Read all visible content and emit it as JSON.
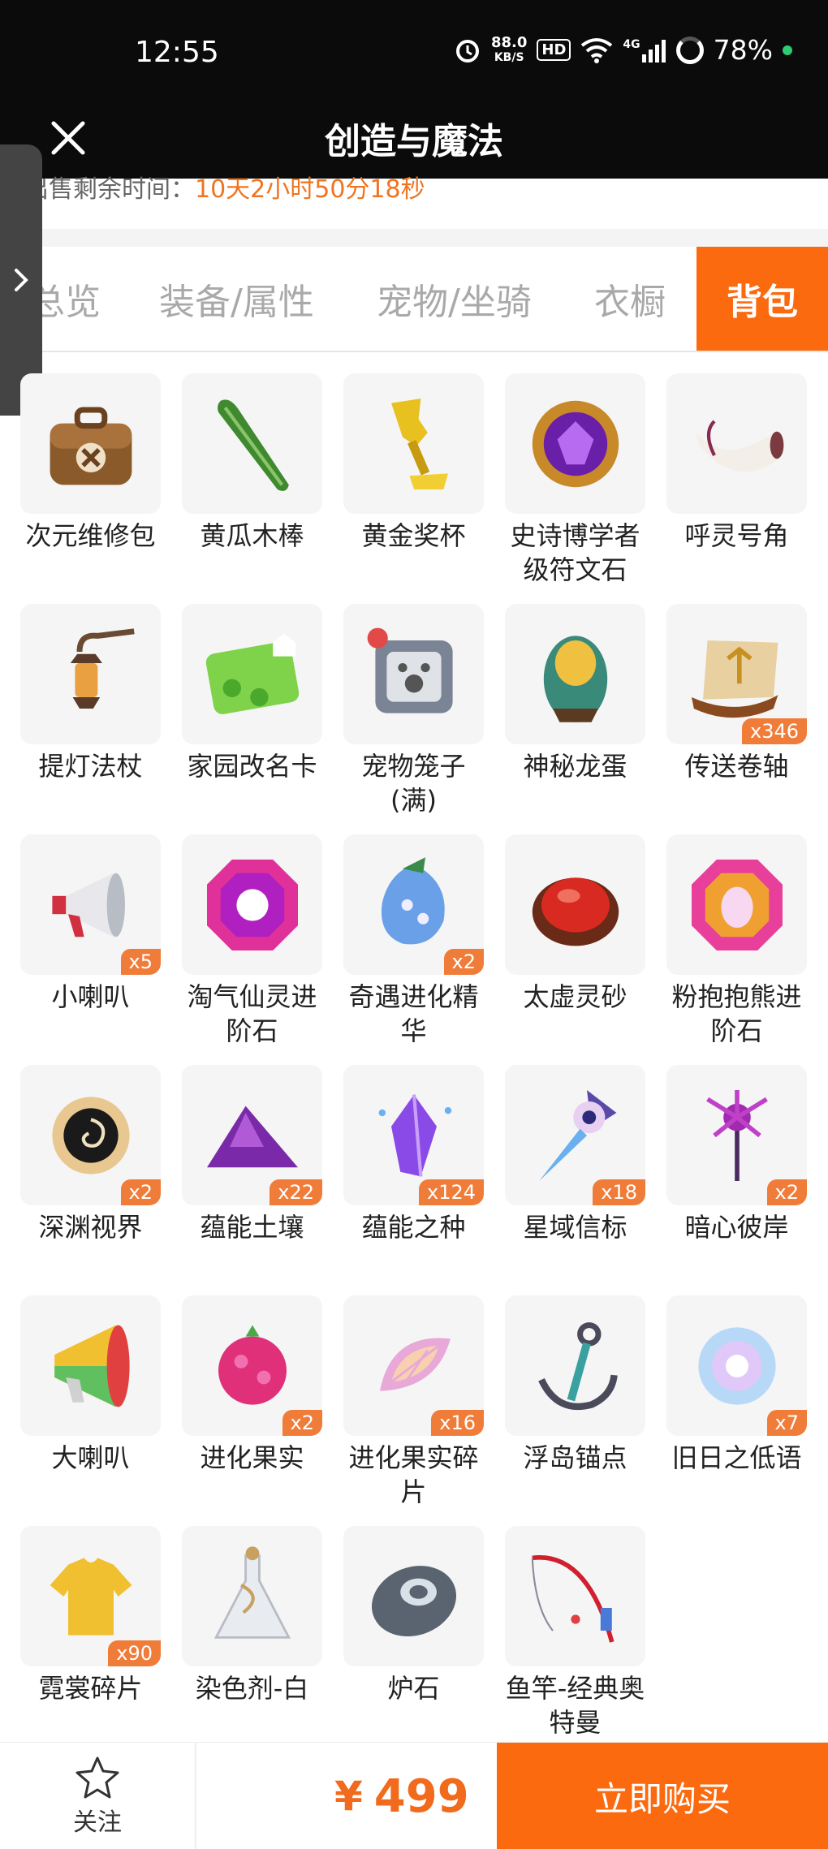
{
  "status_bar": {
    "time": "12:55",
    "net_speed_value": "88.0",
    "net_speed_unit": "KB/S",
    "hd_label": "HD",
    "network_label": "4G",
    "battery": "78%"
  },
  "header": {
    "title": "创造与魔法",
    "close_icon": "close-icon"
  },
  "sale": {
    "label": "出售剩余时间：",
    "countdown": "10天2小时50分18秒"
  },
  "tabs": [
    {
      "label": "总览",
      "active": false
    },
    {
      "label": "装备/属性",
      "active": false
    },
    {
      "label": "宠物/坐骑",
      "active": false
    },
    {
      "label": "衣橱",
      "active": false
    },
    {
      "label": "背包",
      "active": true
    }
  ],
  "items": [
    {
      "name": "次元维修包",
      "qty": "",
      "icon": "repair-bag-icon"
    },
    {
      "name": "黄瓜木棒",
      "qty": "",
      "icon": "cucumber-stick-icon"
    },
    {
      "name": "黄金奖杯",
      "qty": "",
      "icon": "golden-trophy-icon"
    },
    {
      "name": "史诗博学者级符文石",
      "qty": "",
      "icon": "epic-rune-stone-icon"
    },
    {
      "name": "呼灵号角",
      "qty": "",
      "icon": "summon-horn-icon"
    },
    {
      "name": "提灯法杖",
      "qty": "",
      "icon": "lantern-staff-icon"
    },
    {
      "name": "家园改名卡",
      "qty": "",
      "icon": "rename-card-icon"
    },
    {
      "name": "宠物笼子(满)",
      "qty": "",
      "icon": "pet-cage-icon"
    },
    {
      "name": "神秘龙蛋",
      "qty": "",
      "icon": "dragon-egg-icon"
    },
    {
      "name": "传送卷轴",
      "qty": "x346",
      "icon": "teleport-scroll-icon"
    },
    {
      "name": "小喇叭",
      "qty": "x5",
      "icon": "small-megaphone-icon"
    },
    {
      "name": "淘气仙灵进阶石",
      "qty": "",
      "icon": "fairy-advance-stone-icon"
    },
    {
      "name": "奇遇进化精华",
      "qty": "x2",
      "icon": "evolution-essence-icon"
    },
    {
      "name": "太虚灵砂",
      "qty": "",
      "icon": "spirit-sand-icon"
    },
    {
      "name": "粉抱抱熊进阶石",
      "qty": "",
      "icon": "bear-advance-stone-icon"
    },
    {
      "name": "深渊视界",
      "qty": "x2",
      "icon": "abyss-vision-icon"
    },
    {
      "name": "蕴能土壤",
      "qty": "x22",
      "icon": "energy-soil-icon"
    },
    {
      "name": "蕴能之种",
      "qty": "x124",
      "icon": "energy-seed-icon"
    },
    {
      "name": "星域信标",
      "qty": "x18",
      "icon": "star-beacon-icon"
    },
    {
      "name": "暗心彼岸",
      "qty": "x2",
      "icon": "dark-flower-icon"
    },
    {
      "name": "大喇叭",
      "qty": "",
      "icon": "big-megaphone-icon"
    },
    {
      "name": "进化果实",
      "qty": "x2",
      "icon": "evolution-fruit-icon"
    },
    {
      "name": "进化果实碎片",
      "qty": "x16",
      "icon": "fruit-fragment-icon"
    },
    {
      "name": "浮岛锚点",
      "qty": "",
      "icon": "island-anchor-icon"
    },
    {
      "name": "旧日之低语",
      "qty": "x7",
      "icon": "old-whisper-orb-icon"
    },
    {
      "name": "霓裳碎片",
      "qty": "x90",
      "icon": "clothing-fragment-icon"
    },
    {
      "name": "染色剂-白",
      "qty": "",
      "icon": "white-dye-icon"
    },
    {
      "name": "炉石",
      "qty": "",
      "icon": "hearthstone-icon"
    },
    {
      "name": "鱼竿-经典奥特曼",
      "qty": "",
      "icon": "fishing-rod-icon"
    }
  ],
  "footer": {
    "follow_label": "关注",
    "currency": "¥",
    "price": "499",
    "buy_label": "立即购买"
  },
  "colors": {
    "accent": "#fb6a0f",
    "countdown": "#f0741f",
    "badge": "#f07c3a"
  }
}
